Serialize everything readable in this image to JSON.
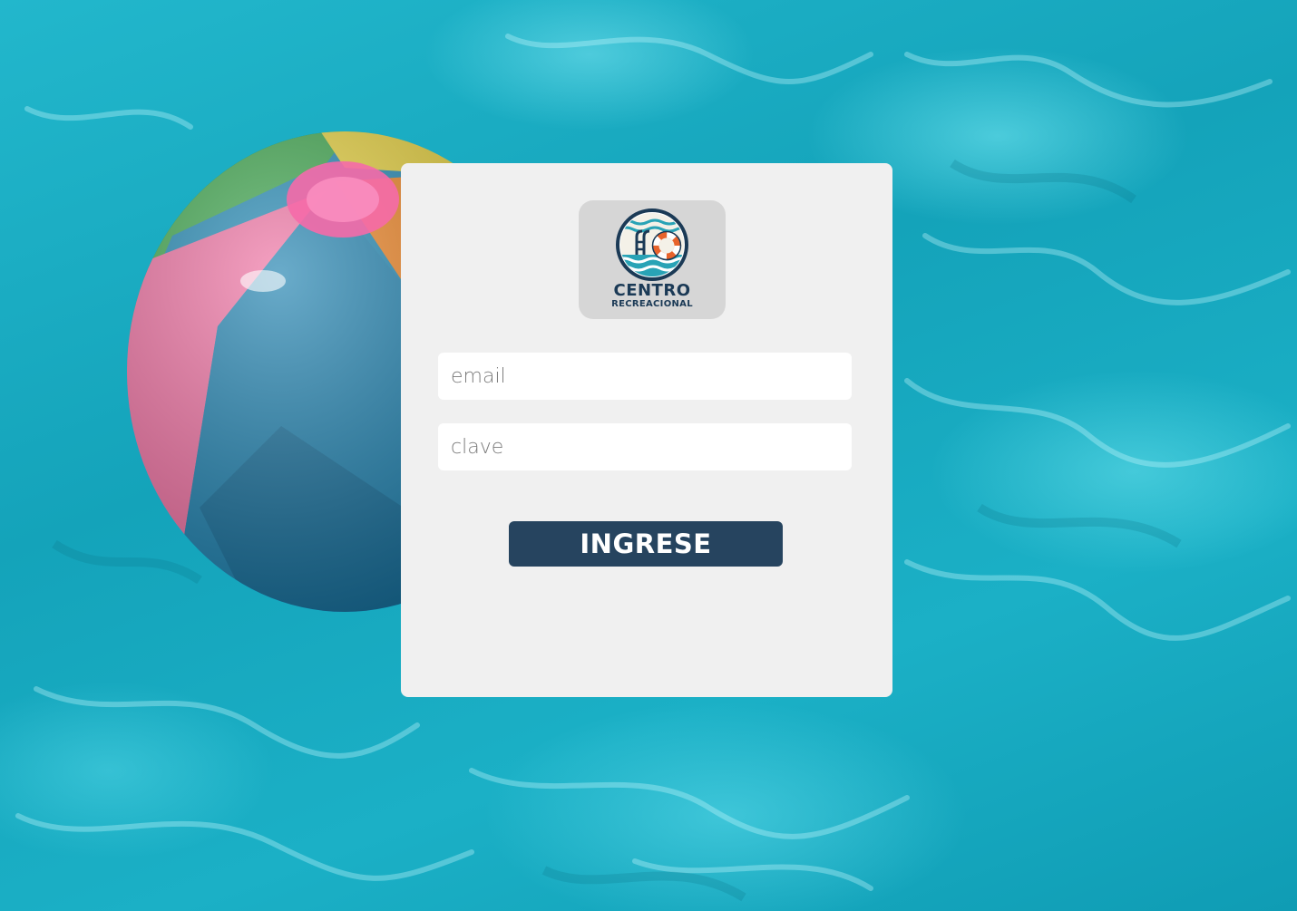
{
  "logo": {
    "title": "CENTRO",
    "subtitle": "RECREACIONAL",
    "icon": "pool-lifebuoy-icon"
  },
  "form": {
    "email_placeholder": "email",
    "password_placeholder": "clave",
    "email_value": "",
    "password_value": ""
  },
  "submit": {
    "label": "INGRESE"
  },
  "colors": {
    "button": "#26445f",
    "card": "#f0f0f0",
    "logo_bg": "#d6d6d6",
    "water": "#1eaec4"
  }
}
